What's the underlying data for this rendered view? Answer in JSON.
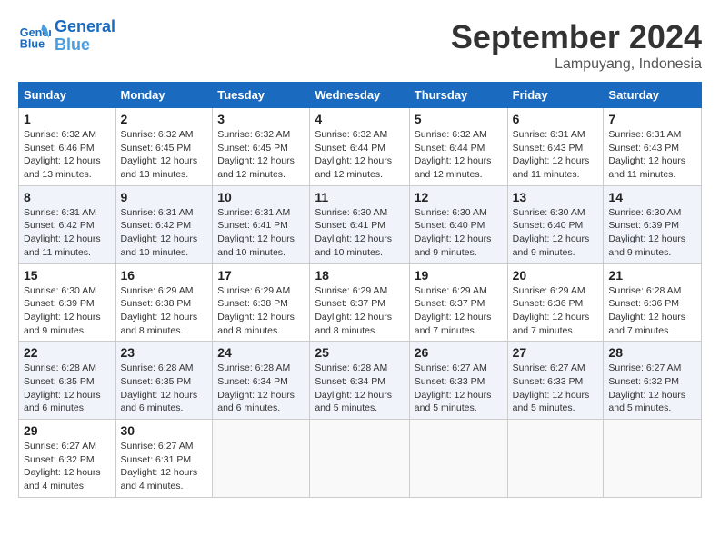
{
  "header": {
    "logo_line1": "General",
    "logo_line2": "Blue",
    "month": "September 2024",
    "location": "Lampuyang, Indonesia"
  },
  "days_of_week": [
    "Sunday",
    "Monday",
    "Tuesday",
    "Wednesday",
    "Thursday",
    "Friday",
    "Saturday"
  ],
  "weeks": [
    [
      {
        "day": "1",
        "sunrise": "6:32 AM",
        "sunset": "6:46 PM",
        "daylight": "12 hours and 13 minutes."
      },
      {
        "day": "2",
        "sunrise": "6:32 AM",
        "sunset": "6:45 PM",
        "daylight": "12 hours and 13 minutes."
      },
      {
        "day": "3",
        "sunrise": "6:32 AM",
        "sunset": "6:45 PM",
        "daylight": "12 hours and 12 minutes."
      },
      {
        "day": "4",
        "sunrise": "6:32 AM",
        "sunset": "6:44 PM",
        "daylight": "12 hours and 12 minutes."
      },
      {
        "day": "5",
        "sunrise": "6:32 AM",
        "sunset": "6:44 PM",
        "daylight": "12 hours and 12 minutes."
      },
      {
        "day": "6",
        "sunrise": "6:31 AM",
        "sunset": "6:43 PM",
        "daylight": "12 hours and 11 minutes."
      },
      {
        "day": "7",
        "sunrise": "6:31 AM",
        "sunset": "6:43 PM",
        "daylight": "12 hours and 11 minutes."
      }
    ],
    [
      {
        "day": "8",
        "sunrise": "6:31 AM",
        "sunset": "6:42 PM",
        "daylight": "12 hours and 11 minutes."
      },
      {
        "day": "9",
        "sunrise": "6:31 AM",
        "sunset": "6:42 PM",
        "daylight": "12 hours and 10 minutes."
      },
      {
        "day": "10",
        "sunrise": "6:31 AM",
        "sunset": "6:41 PM",
        "daylight": "12 hours and 10 minutes."
      },
      {
        "day": "11",
        "sunrise": "6:30 AM",
        "sunset": "6:41 PM",
        "daylight": "12 hours and 10 minutes."
      },
      {
        "day": "12",
        "sunrise": "6:30 AM",
        "sunset": "6:40 PM",
        "daylight": "12 hours and 9 minutes."
      },
      {
        "day": "13",
        "sunrise": "6:30 AM",
        "sunset": "6:40 PM",
        "daylight": "12 hours and 9 minutes."
      },
      {
        "day": "14",
        "sunrise": "6:30 AM",
        "sunset": "6:39 PM",
        "daylight": "12 hours and 9 minutes."
      }
    ],
    [
      {
        "day": "15",
        "sunrise": "6:30 AM",
        "sunset": "6:39 PM",
        "daylight": "12 hours and 9 minutes."
      },
      {
        "day": "16",
        "sunrise": "6:29 AM",
        "sunset": "6:38 PM",
        "daylight": "12 hours and 8 minutes."
      },
      {
        "day": "17",
        "sunrise": "6:29 AM",
        "sunset": "6:38 PM",
        "daylight": "12 hours and 8 minutes."
      },
      {
        "day": "18",
        "sunrise": "6:29 AM",
        "sunset": "6:37 PM",
        "daylight": "12 hours and 8 minutes."
      },
      {
        "day": "19",
        "sunrise": "6:29 AM",
        "sunset": "6:37 PM",
        "daylight": "12 hours and 7 minutes."
      },
      {
        "day": "20",
        "sunrise": "6:29 AM",
        "sunset": "6:36 PM",
        "daylight": "12 hours and 7 minutes."
      },
      {
        "day": "21",
        "sunrise": "6:28 AM",
        "sunset": "6:36 PM",
        "daylight": "12 hours and 7 minutes."
      }
    ],
    [
      {
        "day": "22",
        "sunrise": "6:28 AM",
        "sunset": "6:35 PM",
        "daylight": "12 hours and 6 minutes."
      },
      {
        "day": "23",
        "sunrise": "6:28 AM",
        "sunset": "6:35 PM",
        "daylight": "12 hours and 6 minutes."
      },
      {
        "day": "24",
        "sunrise": "6:28 AM",
        "sunset": "6:34 PM",
        "daylight": "12 hours and 6 minutes."
      },
      {
        "day": "25",
        "sunrise": "6:28 AM",
        "sunset": "6:34 PM",
        "daylight": "12 hours and 5 minutes."
      },
      {
        "day": "26",
        "sunrise": "6:27 AM",
        "sunset": "6:33 PM",
        "daylight": "12 hours and 5 minutes."
      },
      {
        "day": "27",
        "sunrise": "6:27 AM",
        "sunset": "6:33 PM",
        "daylight": "12 hours and 5 minutes."
      },
      {
        "day": "28",
        "sunrise": "6:27 AM",
        "sunset": "6:32 PM",
        "daylight": "12 hours and 5 minutes."
      }
    ],
    [
      {
        "day": "29",
        "sunrise": "6:27 AM",
        "sunset": "6:32 PM",
        "daylight": "12 hours and 4 minutes."
      },
      {
        "day": "30",
        "sunrise": "6:27 AM",
        "sunset": "6:31 PM",
        "daylight": "12 hours and 4 minutes."
      },
      null,
      null,
      null,
      null,
      null
    ]
  ]
}
